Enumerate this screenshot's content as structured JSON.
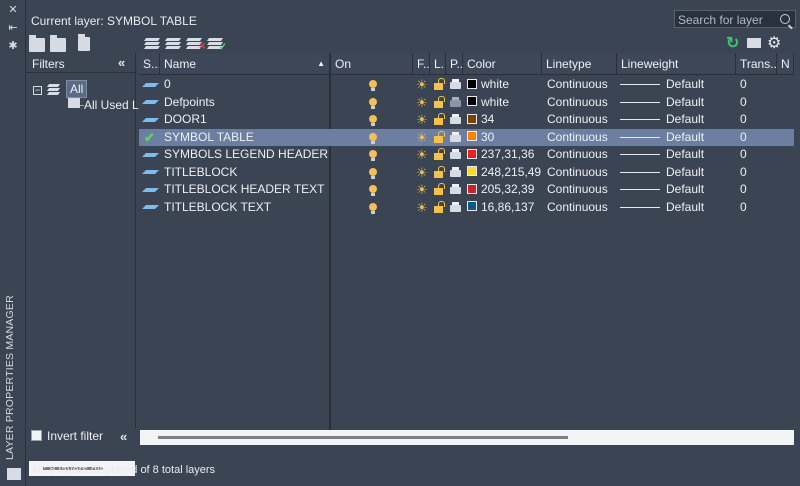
{
  "panel": {
    "vertical_title": "LAYER PROPERTIES MANAGER"
  },
  "header": {
    "current_layer": "Current layer: SYMBOL TABLE",
    "search_placeholder": "Search for layer"
  },
  "filters": {
    "title": "Filters",
    "tree_all": "All",
    "tree_used": "All Used La",
    "invert_label": "Invert filter",
    "invert_checked": false
  },
  "columns": [
    "S...",
    "Name",
    "On",
    "F...",
    "L...",
    "P...",
    "Color",
    "Linetype",
    "Lineweight",
    "Trans...",
    "N"
  ],
  "layers": [
    {
      "status": "para",
      "name": "0",
      "color_hex": "#000000",
      "color": "white",
      "linetype": "Continuous",
      "lineweight": "Default",
      "transparency": "0",
      "plot": true
    },
    {
      "status": "para",
      "name": "Defpoints",
      "color_hex": "#000000",
      "color": "white",
      "linetype": "Continuous",
      "lineweight": "Default",
      "transparency": "0",
      "plot": false
    },
    {
      "status": "para",
      "name": "DOOR1",
      "color_hex": "#7f3f00",
      "color": "34",
      "linetype": "Continuous",
      "lineweight": "Default",
      "transparency": "0",
      "plot": true
    },
    {
      "status": "current",
      "name": "SYMBOL TABLE",
      "color_hex": "#ff7f00",
      "color": "30",
      "linetype": "Continuous",
      "lineweight": "Default",
      "transparency": "0",
      "plot": true
    },
    {
      "status": "para",
      "name": "SYMBOLS LEGEND HEADER",
      "color_hex": "#ed1f24",
      "color": "237,31,36",
      "linetype": "Continuous",
      "lineweight": "Default",
      "transparency": "0",
      "plot": true
    },
    {
      "status": "para",
      "name": "TITLEBLOCK",
      "color_hex": "#f8d731",
      "color": "248,215,49",
      "linetype": "Continuous",
      "lineweight": "Default",
      "transparency": "0",
      "plot": true
    },
    {
      "status": "para",
      "name": "TITLEBLOCK HEADER TEXT",
      "color_hex": "#cd2027",
      "color": "205,32,39",
      "linetype": "Continuous",
      "lineweight": "Default",
      "transparency": "0",
      "plot": true
    },
    {
      "status": "para",
      "name": "TITLEBLOCK TEXT",
      "color_hex": "#105689",
      "color": "16,86,137",
      "linetype": "Continuous",
      "lineweight": "Default",
      "transparency": "0",
      "plot": true
    }
  ],
  "selected_row": 3,
  "status_bar": "All: 8 layers displayed of 8 total layers",
  "colors": {
    "background": "#3b4453",
    "selection": "#6c7fa0",
    "layer_icon": "#7dbcf0",
    "current_check": "#5fd36a",
    "refresh_icon": "#3ec46d"
  }
}
